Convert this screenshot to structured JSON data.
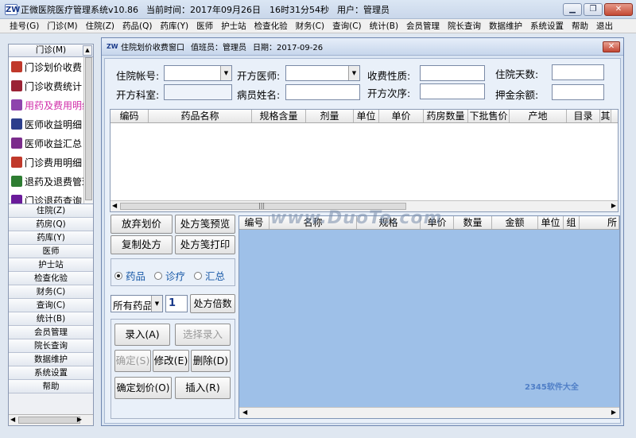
{
  "app": {
    "title": "正微医院医疗管理系统v10.86",
    "time": "当前时间：2017年09月26日　16时31分54秒",
    "user": "用户：管理员"
  },
  "menu": [
    "挂号(G)",
    "门诊(M)",
    "住院(Z)",
    "药品(Q)",
    "药库(Y)",
    "医师",
    "护士站",
    "检查化验",
    "财务(C)",
    "查询(C)",
    "统计(B)",
    "会员管理",
    "院长查询",
    "数据维护",
    "系统设置",
    "帮助",
    "退出"
  ],
  "left": {
    "header": "门诊(M)",
    "items": [
      {
        "label": "门诊划价收费",
        "color": "#c0392b"
      },
      {
        "label": "门诊收费统计",
        "color": "#9b2335"
      },
      {
        "label": "用药及费用明细",
        "color": "#8e44ad"
      },
      {
        "label": "医师收益明细",
        "color": "#2c3e8c"
      },
      {
        "label": "医师收益汇总",
        "color": "#7b2c8c"
      },
      {
        "label": "门诊费用明细",
        "color": "#c0392b"
      },
      {
        "label": "退药及退费管理",
        "color": "#2e7d32"
      },
      {
        "label": "门诊退药查询",
        "color": "#6a1b9a"
      }
    ],
    "nav": [
      "住院(Z)",
      "药房(Q)",
      "药库(Y)",
      "医师",
      "护士站",
      "检查化验",
      "财务(C)",
      "查询(C)",
      "统计(B)",
      "会员管理",
      "院长查询",
      "数据维护",
      "系统设置",
      "帮助"
    ]
  },
  "child": {
    "title": "住院划价收费窗口",
    "cashier": "值班员：管理员",
    "date": "日期：2017-09-26",
    "form": {
      "account_label": "住院帐号:",
      "doctor_label": "开方医师:",
      "nature_label": "收费性质:",
      "days_label": "住院天数:",
      "dept_label": "开方科室:",
      "patient_label": "病员姓名:",
      "order_label": "开方次序:",
      "deposit_label": "押金余额:"
    },
    "grid1_headers": [
      "编码",
      "药品名称",
      "规格含量",
      "剂量",
      "单位",
      "单价",
      "药房数量",
      "下批售价",
      "产地",
      "目录",
      "其"
    ],
    "grid2_headers": [
      "编号",
      "名称",
      "规格",
      "单价",
      "数量",
      "金额",
      "单位",
      "组",
      "所"
    ],
    "buttons": {
      "abandon": "放弃划价",
      "rx_preview": "处方笺预览",
      "copy_rx": "复制处方",
      "rx_print": "处方笺打印",
      "rx_multiple": "处方倍数",
      "enter": "录入(A)",
      "select_enter": "选择录入",
      "confirm": "确定(S)",
      "modify": "修改(E)",
      "delete": "删除(D)",
      "confirm_price": "确定划价(O)",
      "insert": "插入(R)"
    },
    "radios": [
      "药品",
      "诊疗",
      "汇总"
    ],
    "filter_select": "所有药品",
    "multiple_value": "1"
  },
  "watermarks": {
    "main": "www.DuoTe.com",
    "brand": "2345软件大全"
  }
}
